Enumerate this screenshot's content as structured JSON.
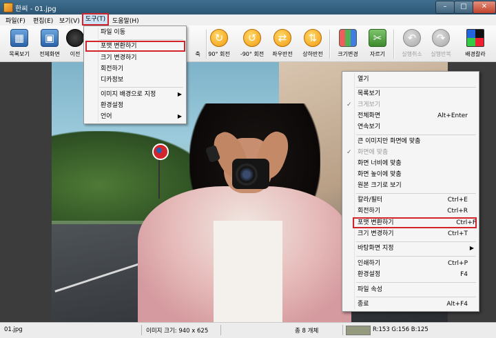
{
  "window": {
    "title": "한씨 - 01.jpg"
  },
  "menubar": [
    "파일(F)",
    "편집(E)",
    "보기(V)",
    "도구(T)",
    "도움말(H)"
  ],
  "toolbar": {
    "list": "목록보기",
    "fullscreen": "전체화면",
    "prev": "이전",
    "more": "축",
    "rot90": "90° 회전",
    "rotm90": "-90° 회전",
    "fliph": "좌우반전",
    "flipv": "상하반전",
    "resize": "크기변경",
    "crop": "자르기",
    "undo": "실행취소",
    "redo": "실행반복",
    "bgcolor": "배경칼라"
  },
  "tools_menu": {
    "items": [
      "파일 이동",
      "포맷 변환하기",
      "크기 변경하기",
      "회전하기",
      "디카정보",
      "이미지 배경으로 지정",
      "환경설정",
      "언어"
    ]
  },
  "context_menu": {
    "open": "열기",
    "list": "목록보기",
    "bigview": "크게보기",
    "fullscreen": "전체화면",
    "fullscreen_key": "Alt+Enter",
    "slideshow": "연속보기",
    "fit_big": "큰 이미지만 화면에 맞춤",
    "fit_screen": "화면에 맞춤",
    "fit_width": "화면 너비에 맞춤",
    "fit_height": "화면 높이에 맞춤",
    "original": "원본 크기로 보기",
    "color": "칼라/필터",
    "color_key": "Ctrl+E",
    "rotate": "회전하기",
    "rotate_key": "Ctrl+R",
    "convert": "포맷 변환하기",
    "convert_key": "Ctrl+F",
    "resize": "크기 변경하기",
    "resize_key": "Ctrl+T",
    "wallpaper": "바탕화면 지정",
    "print": "인쇄하기",
    "print_key": "Ctrl+P",
    "settings": "환경설정",
    "settings_key": "F4",
    "properties": "파일 속성",
    "exit": "종료",
    "exit_key": "Alt+F4"
  },
  "statusbar": {
    "filename": "01.jpg",
    "size": "이미지 크기: 940 x 625",
    "total": "총 8 개체",
    "pixel_color": "#949a7d",
    "rgb": "R:153 G:156 B:125"
  }
}
